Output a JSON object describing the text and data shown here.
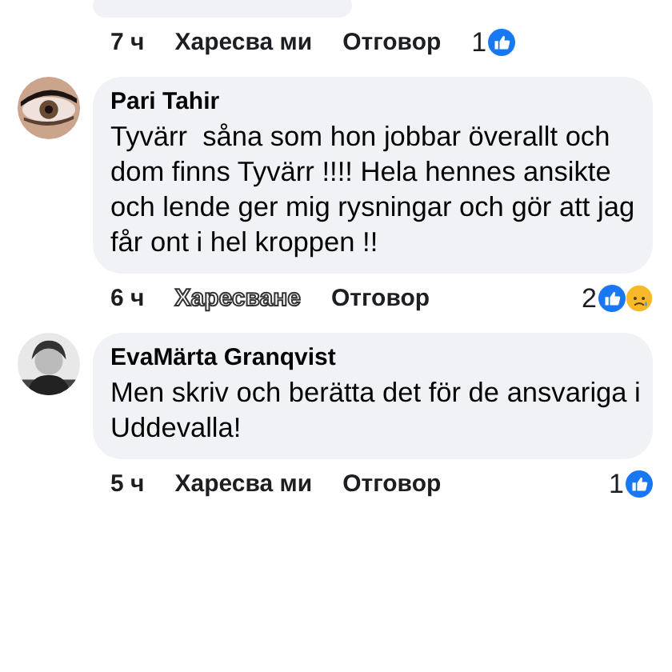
{
  "comments": [
    {
      "cut": true,
      "avatar": false,
      "footer": {
        "time": "7 ч",
        "like_label": "Харесва ми",
        "like_outlined": false,
        "reply_label": "Отговор",
        "reaction_count": "1",
        "reactions": [
          {
            "kind": "like"
          }
        ]
      }
    },
    {
      "author": "Pari Tahir",
      "text": "Tyvärr  såna som hon jobbar överallt och dom finns Tyvärr !!!! Hela hennes ansikte och lende ger mig rysningar och gör att jag får ont i hel kroppen !!",
      "cut": false,
      "avatar": true,
      "footer": {
        "time": "6 ч",
        "like_label": "Харесване",
        "like_outlined": true,
        "reply_label": "Отговор",
        "reaction_count": "2",
        "reactions": [
          {
            "kind": "like"
          },
          {
            "kind": "sad"
          }
        ]
      }
    },
    {
      "author": "EvaMärta Granqvist",
      "text": "Men skriv och berätta det för de ansvariga i Uddevalla!",
      "cut": false,
      "avatar": true,
      "footer": {
        "time": "5 ч",
        "like_label": "Харесва ми",
        "like_outlined": false,
        "reply_label": "Отговор",
        "reaction_count": "1",
        "reactions": [
          {
            "kind": "like"
          }
        ]
      }
    }
  ]
}
